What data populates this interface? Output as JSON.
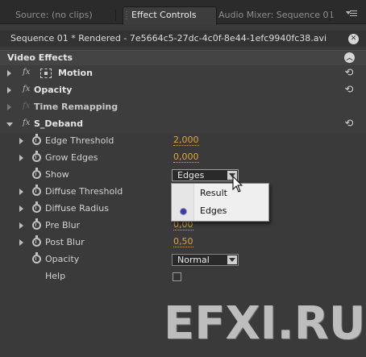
{
  "tabs": [
    {
      "label": "Source: (no clips)",
      "active": false
    },
    {
      "label": "Effect Controls",
      "active": true
    },
    {
      "label": "Audio Mixer: Sequence 01",
      "active": false
    }
  ],
  "panel_menu_icon": "panel-menu-icon",
  "sequence": {
    "label": "Sequence 01 * Rendered - 7e5664c5-27dc-4c0f-8e44-1efc9940fc38.avi",
    "close_icon": "close-circle-icon"
  },
  "video_effects": {
    "title": "Video Effects",
    "collapse_icon": "collapse-up-icon"
  },
  "effects": {
    "motion": {
      "fx": "fx",
      "name": "Motion",
      "expanded": false
    },
    "opacity": {
      "fx": "fx",
      "name": "Opacity",
      "expanded": false
    },
    "time_remapping": {
      "fx": "fx",
      "name": "Time Remapping",
      "expanded": false
    },
    "s_deband": {
      "fx": "fx",
      "name": "S_Deband",
      "expanded": true
    }
  },
  "params": {
    "edge_threshold": {
      "name": "Edge Threshold",
      "value": "2,000"
    },
    "grow_edges": {
      "name": "Grow Edges",
      "value": "0,000"
    },
    "show": {
      "name": "Show",
      "value": "Edges"
    },
    "diffuse_threshold": {
      "name": "Diffuse Threshold",
      "value": ""
    },
    "diffuse_radius": {
      "name": "Diffuse Radius",
      "value": ""
    },
    "pre_blur": {
      "name": "Pre Blur",
      "value": "0,00"
    },
    "post_blur": {
      "name": "Post Blur",
      "value": "0,50"
    },
    "opacity": {
      "name": "Opacity",
      "value": "Normal"
    },
    "help": {
      "name": "Help",
      "checked": false
    }
  },
  "popup": {
    "options": [
      {
        "label": "Result",
        "selected": false
      },
      {
        "label": "Edges",
        "selected": true
      }
    ]
  },
  "watermark": "EFXI.RU",
  "colors": {
    "value_accent": "#e6a43a",
    "panel_bg": "#3a3a3a",
    "selection_bullet": "#3c3ca0"
  }
}
